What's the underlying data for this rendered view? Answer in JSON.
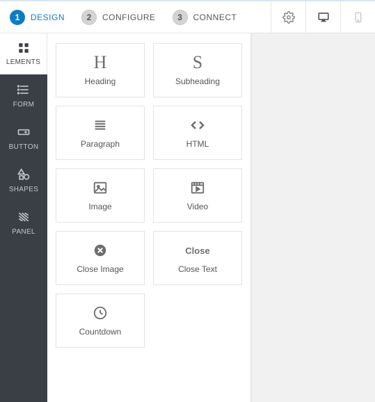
{
  "steps": [
    {
      "num": "1",
      "label": "DESIGN",
      "active": true
    },
    {
      "num": "2",
      "label": "CONFIGURE",
      "active": false
    },
    {
      "num": "3",
      "label": "CONNECT",
      "active": false
    }
  ],
  "sidebar": {
    "top": {
      "label": "LEMENTS"
    },
    "items": [
      {
        "label": "FORM"
      },
      {
        "label": "BUTTON"
      },
      {
        "label": "SHAPES"
      },
      {
        "label": "PANEL"
      }
    ]
  },
  "elements": [
    {
      "icon_char": "H",
      "label": "Heading"
    },
    {
      "icon_char": "S",
      "label": "Subheading"
    },
    {
      "icon": "paragraph",
      "label": "Paragraph"
    },
    {
      "icon": "code",
      "label": "HTML"
    },
    {
      "icon": "image",
      "label": "Image"
    },
    {
      "icon": "video",
      "label": "Video"
    },
    {
      "icon": "close",
      "label": "Close Image"
    },
    {
      "icon_text": "Close",
      "label": "Close Text"
    },
    {
      "icon": "clock",
      "label": "Countdown"
    }
  ]
}
